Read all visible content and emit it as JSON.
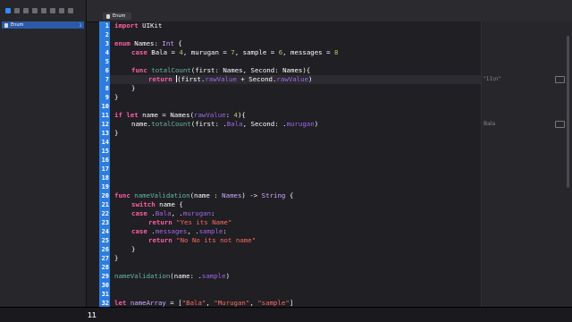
{
  "sidebar": {
    "project_name": "Enum",
    "project_badge": "3"
  },
  "tabs": [
    {
      "label": "Enum"
    }
  ],
  "gutter": {
    "line_numbers": [
      "1",
      "2",
      "3",
      "4",
      "5",
      "6",
      "7",
      "8",
      "9",
      "10",
      "11",
      "12",
      "13",
      "14",
      "15",
      "16",
      "17",
      "18",
      "19",
      "20",
      "21",
      "22",
      "23",
      "24",
      "25",
      "26",
      "27",
      "28",
      "29",
      "30",
      "31",
      "32"
    ]
  },
  "editor": {
    "lines": {
      "l1": [
        "import",
        " UIKit"
      ],
      "l3": [
        "enum",
        " Names",
        ": ",
        "Int",
        " {"
      ],
      "l4": [
        "case",
        " Bala = ",
        "4",
        ", murugan = ",
        "7",
        ", sample = ",
        "6",
        ", messages = ",
        "8"
      ],
      "l6": [
        "func",
        " ",
        "totalCount",
        "(first: Names, Second: Names){"
      ],
      "l7a": [
        "return",
        " ",
        "(first.",
        "rawValue",
        " + Second.",
        "rawValue",
        ")"
      ],
      "l8": [
        "}"
      ],
      "l9": [
        "}"
      ],
      "l11": [
        "if",
        " ",
        "let",
        " name = Names(",
        "rawValue",
        ": ",
        "4",
        "){"
      ],
      "l12": [
        "name.",
        "totalCount",
        "(first: .",
        "Bala",
        ", Second: .",
        "murugan",
        ")"
      ],
      "l13": [
        "}"
      ],
      "l20": [
        "func",
        " ",
        "nameValidation",
        "(name : ",
        "Names",
        ") -> ",
        "String",
        " {"
      ],
      "l21": [
        "switch",
        " name {"
      ],
      "l22": [
        "case",
        " .",
        "Bala",
        ", .",
        "murugan",
        ":"
      ],
      "l23": [
        "return",
        " ",
        "\"Yes its Name\""
      ],
      "l24": [
        "case",
        " .",
        "messages",
        ", .",
        "sample",
        ":"
      ],
      "l25": [
        "return",
        " ",
        "\"No No its not name\""
      ],
      "l26": [
        "}"
      ],
      "l27": [
        "}"
      ],
      "l29": [
        "nameValidation",
        "(name: .",
        "sample",
        ")"
      ],
      "l32": [
        "let",
        " ",
        "nameArray",
        " = [",
        "\"Bala\"",
        ", ",
        "\"Murugan\"",
        ", ",
        "\"sample\"",
        "]"
      ]
    }
  },
  "results": {
    "r7": "\"11\\n\"",
    "r12": "Bala"
  },
  "bottom": {
    "line_indicator": "11"
  },
  "colors": {
    "keyword": "#fc5fa3",
    "type": "#d0a8ff",
    "function": "#67b7a4",
    "property": "#a167e6",
    "number": "#d0bf69",
    "string": "#fc6a5d",
    "gutter": "#2d7de0"
  }
}
